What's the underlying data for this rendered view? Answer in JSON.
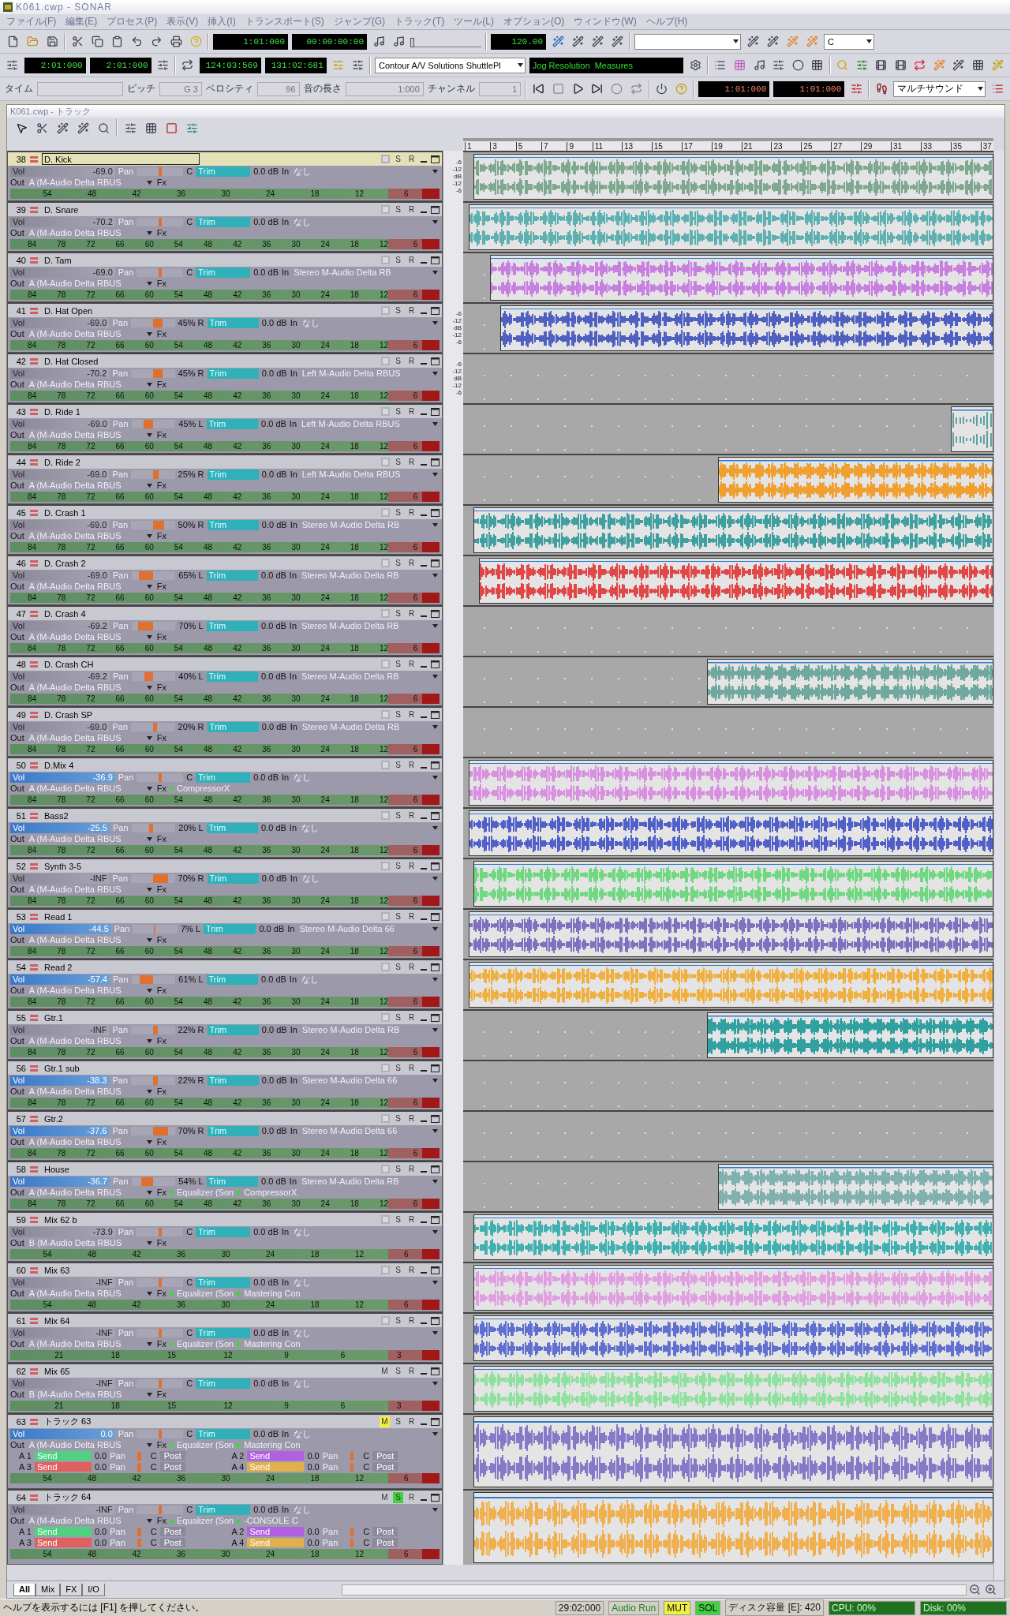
{
  "window": {
    "title": "K061.cwp - SONAR"
  },
  "menu": [
    "ファイル(F)",
    "編集(E)",
    "プロセス(P)",
    "表示(V)",
    "挿入(I)",
    "トランスポート(S)",
    "ジャンプ(G)",
    "トラック(T)",
    "ツール(L)",
    "オプション(O)",
    "ウィンドウ(W)",
    "ヘルプ(H)"
  ],
  "toolbar_1": {
    "now_time": "1:01:000",
    "smpte": "00:00:00:00",
    "tempo": "120.00",
    "position": {
      "level": 0
    },
    "key_combo": "C"
  },
  "toolbar_2": {
    "from": "2:01:000",
    "thru": "2:01:000",
    "loop_start": "124:03:569",
    "loop_end": "131:02:681",
    "controller_combo": "Contour A/V Solutions ShuttlePl",
    "jog_display": "Jog Resolution  Measures"
  },
  "toolbar_3": {
    "event_fields": [
      {
        "label": "タイム",
        "disabled": true
      },
      {
        "label": "ピッチ",
        "value": "G 3",
        "disabled": true
      },
      {
        "label": "ベロシティ",
        "value": "96",
        "disabled": true
      },
      {
        "label": "音の長さ",
        "value": "1:000",
        "disabled": true
      },
      {
        "label": "チャンネル",
        "value": "1",
        "disabled": true
      }
    ],
    "punch_in": "1:01:000",
    "punch_out": "1:01:000",
    "sound_combo": "マルチサウンド"
  },
  "track_window": {
    "title": "K061.cwp - トラック"
  },
  "ruler": [
    "1",
    "3",
    "5",
    "7",
    "9",
    "11",
    "13",
    "15",
    "17",
    "19",
    "21",
    "23",
    "25",
    "27",
    "29",
    "31",
    "33",
    "35",
    "37"
  ],
  "tracks": [
    {
      "number": "38",
      "name": "D. Kick",
      "selected": true,
      "vol_label": "Vol",
      "vol": "-69.0",
      "vol_highlighted": false,
      "pan_label": "Pan",
      "pan": "C",
      "trim": "Trim",
      "trim_value": "0.0 dB",
      "in_label": "In",
      "input": "なし",
      "out_label": "Out",
      "output": "A (M-Audio Delta RBUS",
      "fx_label": "Fx",
      "meter": [
        "54",
        "48",
        "42",
        "36",
        "30",
        "24",
        "18",
        "12",
        "6"
      ],
      "muted": false,
      "solo_label": "S",
      "soloed": false,
      "record_label": "R",
      "db_scale": [
        "-6",
        "-12",
        "dB",
        "-12",
        "-6"
      ],
      "clip": {
        "color": "#7fa890"
      }
    },
    {
      "number": "39",
      "name": "D. Snare",
      "selected": false,
      "vol_label": "Vol",
      "vol": "-70.2",
      "vol_highlighted": false,
      "pan_label": "Pan",
      "pan": "C",
      "trim": "Trim",
      "trim_value": "0.0 dB",
      "in_label": "In",
      "input": "なし",
      "out_label": "Out",
      "output": "A (M-Audio Delta RBUS",
      "fx_label": "Fx",
      "meter": [
        "84",
        "78",
        "72",
        "66",
        "60",
        "54",
        "48",
        "42",
        "36",
        "30",
        "24",
        "18",
        "12",
        "6"
      ],
      "muted": false,
      "solo_label": "S",
      "soloed": false,
      "record_label": "R",
      "clip": {
        "color": "#5fb0b0"
      }
    },
    {
      "number": "40",
      "name": "D. Tam",
      "selected": false,
      "vol_label": "Vol",
      "vol": "-69.0",
      "vol_highlighted": false,
      "pan_label": "Pan",
      "pan": "C",
      "trim": "Trim",
      "trim_value": "0.0 dB",
      "in_label": "In",
      "input": "Stereo M-Audio Delta RB",
      "out_label": "Out",
      "output": "A (M-Audio Delta RBUS",
      "fx_label": "Fx",
      "meter": [
        "84",
        "78",
        "72",
        "66",
        "60",
        "54",
        "48",
        "42",
        "36",
        "30",
        "24",
        "18",
        "12",
        "6"
      ],
      "muted": false,
      "solo_label": "S",
      "soloed": false,
      "record_label": "R",
      "clip": {
        "color": "#c880e0"
      }
    },
    {
      "number": "41",
      "name": "D. Hat Open",
      "selected": false,
      "vol_label": "Vol",
      "vol": "-69.0",
      "vol_highlighted": false,
      "pan_label": "Pan",
      "pan": "45% R",
      "trim": "Trim",
      "trim_value": "0.0 dB",
      "in_label": "In",
      "input": "なし",
      "out_label": "Out",
      "output": "A (M-Audio Delta RBUS",
      "fx_label": "Fx",
      "meter": [
        "84",
        "78",
        "72",
        "66",
        "60",
        "54",
        "48",
        "42",
        "36",
        "30",
        "24",
        "18",
        "12",
        "6"
      ],
      "muted": false,
      "solo_label": "S",
      "soloed": false,
      "record_label": "R",
      "db_scale": [
        "-6",
        "-12",
        "dB",
        "-12",
        "-6"
      ],
      "clip": {
        "color": "#5060c0"
      }
    },
    {
      "number": "42",
      "name": "D. Hat Closed",
      "selected": false,
      "vol_label": "Vol",
      "vol": "-70.2",
      "vol_highlighted": false,
      "pan_label": "Pan",
      "pan": "45% R",
      "trim": "Trim",
      "trim_value": "0.0 dB",
      "in_label": "In",
      "input": "Left M-Audio Delta RBUS",
      "out_label": "Out",
      "output": "A (M-Audio Delta RBUS",
      "fx_label": "Fx",
      "meter": [
        "84",
        "78",
        "72",
        "66",
        "60",
        "54",
        "48",
        "42",
        "36",
        "30",
        "24",
        "18",
        "12",
        "6"
      ],
      "muted": false,
      "solo_label": "S",
      "soloed": false,
      "record_label": "R",
      "db_scale": [
        "-6",
        "-12",
        "dB",
        "-12",
        "-6"
      ]
    },
    {
      "number": "43",
      "name": "D. Ride 1",
      "selected": false,
      "vol_label": "Vol",
      "vol": "-69.0",
      "vol_highlighted": false,
      "pan_label": "Pan",
      "pan": "45% L",
      "trim": "Trim",
      "trim_value": "0.0 dB",
      "in_label": "In",
      "input": "Left M-Audio Delta RBUS",
      "out_label": "Out",
      "output": "A (M-Audio Delta RBUS",
      "fx_label": "Fx",
      "meter": [
        "84",
        "78",
        "72",
        "66",
        "60",
        "54",
        "48",
        "42",
        "36",
        "30",
        "24",
        "18",
        "12",
        "6"
      ],
      "muted": false,
      "solo_label": "S",
      "soloed": false,
      "record_label": "R",
      "clip": {
        "color": "#60a0a0"
      }
    },
    {
      "number": "44",
      "name": "D. Ride 2",
      "selected": false,
      "vol_label": "Vol",
      "vol": "-69.0",
      "vol_highlighted": false,
      "pan_label": "Pan",
      "pan": "25% R",
      "trim": "Trim",
      "trim_value": "0.0 dB",
      "in_label": "In",
      "input": "Left M-Audio Delta RBUS",
      "out_label": "Out",
      "output": "A (M-Audio Delta RBUS",
      "fx_label": "Fx",
      "meter": [
        "84",
        "78",
        "72",
        "66",
        "60",
        "54",
        "48",
        "42",
        "36",
        "30",
        "24",
        "18",
        "12",
        "6"
      ],
      "muted": false,
      "solo_label": "S",
      "soloed": false,
      "record_label": "R",
      "clip": {
        "color": "#f0a030"
      }
    },
    {
      "number": "45",
      "name": "D. Crash 1",
      "selected": false,
      "vol_label": "Vol",
      "vol": "-69.0",
      "vol_highlighted": false,
      "pan_label": "Pan",
      "pan": "50% R",
      "trim": "Trim",
      "trim_value": "0.0 dB",
      "in_label": "In",
      "input": "Stereo M-Audio Delta RB",
      "out_label": "Out",
      "output": "A (M-Audio Delta RBUS",
      "fx_label": "Fx",
      "meter": [
        "84",
        "78",
        "72",
        "66",
        "60",
        "54",
        "48",
        "42",
        "36",
        "30",
        "24",
        "18",
        "12",
        "6"
      ],
      "muted": false,
      "solo_label": "S",
      "soloed": false,
      "record_label": "R",
      "clip": {
        "color": "#40a0a0"
      }
    },
    {
      "number": "46",
      "name": "D. Crash 2",
      "selected": false,
      "vol_label": "Vol",
      "vol": "-69.0",
      "vol_highlighted": false,
      "pan_label": "Pan",
      "pan": "65% L",
      "trim": "Trim",
      "trim_value": "0.0 dB",
      "in_label": "In",
      "input": "Stereo M-Audio Delta RB",
      "out_label": "Out",
      "output": "A (M-Audio Delta RBUS",
      "fx_label": "Fx",
      "meter": [
        "84",
        "78",
        "72",
        "66",
        "60",
        "54",
        "48",
        "42",
        "36",
        "30",
        "24",
        "18",
        "12",
        "6"
      ],
      "muted": false,
      "solo_label": "S",
      "soloed": false,
      "record_label": "R",
      "clip": {
        "color": "#e04848"
      }
    },
    {
      "number": "47",
      "name": "D. Crash 4",
      "selected": false,
      "vol_label": "Vol",
      "vol": "-69.2",
      "vol_highlighted": false,
      "pan_label": "Pan",
      "pan": "70% L",
      "trim": "Trim",
      "trim_value": "0.0 dB",
      "in_label": "In",
      "input": "Stereo M-Audio Delta RB",
      "out_label": "Out",
      "output": "A (M-Audio Delta RBUS",
      "fx_label": "Fx",
      "meter": [
        "84",
        "78",
        "72",
        "66",
        "60",
        "54",
        "48",
        "42",
        "36",
        "30",
        "24",
        "18",
        "12",
        "6"
      ],
      "muted": false,
      "solo_label": "S",
      "soloed": false,
      "record_label": "R"
    },
    {
      "number": "48",
      "name": "D. Crash CH",
      "selected": false,
      "vol_label": "Vol",
      "vol": "-69.2",
      "vol_highlighted": false,
      "pan_label": "Pan",
      "pan": "40% L",
      "trim": "Trim",
      "trim_value": "0.0 dB",
      "in_label": "In",
      "input": "Stereo M-Audio Delta RB",
      "out_label": "Out",
      "output": "A (M-Audio Delta RBUS",
      "fx_label": "Fx",
      "meter": [
        "84",
        "78",
        "72",
        "66",
        "60",
        "54",
        "48",
        "42",
        "36",
        "30",
        "24",
        "18",
        "12",
        "6"
      ],
      "muted": false,
      "solo_label": "S",
      "soloed": false,
      "record_label": "R",
      "clip": {
        "color": "#70a8a0"
      }
    },
    {
      "number": "49",
      "name": "D. Crash SP",
      "selected": false,
      "vol_label": "Vol",
      "vol": "-69.0",
      "vol_highlighted": false,
      "pan_label": "Pan",
      "pan": "20% R",
      "trim": "Trim",
      "trim_value": "0.0 dB",
      "in_label": "In",
      "input": "Stereo M-Audio Delta RB",
      "out_label": "Out",
      "output": "A (M-Audio Delta RBUS",
      "fx_label": "Fx",
      "meter": [
        "84",
        "78",
        "72",
        "66",
        "60",
        "54",
        "48",
        "42",
        "36",
        "30",
        "24",
        "18",
        "12",
        "6"
      ],
      "muted": false,
      "solo_label": "S",
      "soloed": false,
      "record_label": "R"
    },
    {
      "number": "50",
      "name": "D.Mix 4",
      "selected": false,
      "vol_label": "Vol",
      "vol": "-36.9",
      "vol_highlighted": true,
      "pan_label": "Pan",
      "pan": "C",
      "trim": "Trim",
      "trim_value": "0.0 dB",
      "in_label": "In",
      "input": "なし",
      "out_label": "Out",
      "output": "A (M-Audio Delta RBUS",
      "fx_label": "Fx",
      "fx": [
        "CompressorX"
      ],
      "meter": [
        "84",
        "78",
        "72",
        "66",
        "60",
        "54",
        "48",
        "42",
        "36",
        "30",
        "24",
        "18",
        "12",
        "6"
      ],
      "muted": false,
      "solo_label": "S",
      "soloed": false,
      "record_label": "R",
      "clip": {
        "color": "#d890e0"
      }
    },
    {
      "number": "51",
      "name": "Bass2",
      "selected": false,
      "vol_label": "Vol",
      "vol": "-25.5",
      "vol_highlighted": true,
      "pan_label": "Pan",
      "pan": "20% L",
      "trim": "Trim",
      "trim_value": "0.0 dB",
      "in_label": "In",
      "input": "なし",
      "out_label": "Out",
      "output": "A (M-Audio Delta RBUS",
      "fx_label": "Fx",
      "meter": [
        "84",
        "78",
        "72",
        "66",
        "60",
        "54",
        "48",
        "42",
        "36",
        "30",
        "24",
        "18",
        "12",
        "6"
      ],
      "muted": false,
      "solo_label": "S",
      "soloed": false,
      "record_label": "R",
      "clip": {
        "color": "#5060c8"
      }
    },
    {
      "number": "52",
      "name": "Synth 3-5",
      "selected": false,
      "vol_label": "Vol",
      "vol": "-INF",
      "vol_highlighted": false,
      "pan_label": "Pan",
      "pan": "70% R",
      "trim": "Trim",
      "trim_value": "0.0 dB",
      "in_label": "In",
      "input": "なし",
      "out_label": "Out",
      "output": "A (M-Audio Delta RBUS",
      "fx_label": "Fx",
      "meter": [
        "84",
        "78",
        "72",
        "66",
        "60",
        "54",
        "48",
        "42",
        "36",
        "30",
        "24",
        "18",
        "12",
        "6"
      ],
      "muted": false,
      "solo_label": "S",
      "soloed": false,
      "record_label": "R",
      "clip": {
        "color": "#70d880"
      }
    },
    {
      "number": "53",
      "name": "Read 1",
      "selected": false,
      "vol_label": "Vol",
      "vol": "-44.5",
      "vol_highlighted": true,
      "pan_label": "Pan",
      "pan": "7% L",
      "trim": "Trim",
      "trim_value": "0.0 dB",
      "in_label": "In",
      "input": "Stereo M-Audio Delta 66",
      "out_label": "Out",
      "output": "A (M-Audio Delta RBUS",
      "fx_label": "Fx",
      "meter": [
        "84",
        "78",
        "72",
        "66",
        "60",
        "54",
        "48",
        "42",
        "36",
        "30",
        "24",
        "18",
        "12",
        "6"
      ],
      "muted": false,
      "solo_label": "S",
      "soloed": false,
      "record_label": "R",
      "clip": {
        "color": "#8070c0"
      }
    },
    {
      "number": "54",
      "name": "Read 2",
      "selected": false,
      "vol_label": "Vol",
      "vol": "-57.4",
      "vol_highlighted": true,
      "pan_label": "Pan",
      "pan": "61% L",
      "trim": "Trim",
      "trim_value": "0.0 dB",
      "in_label": "In",
      "input": "なし",
      "out_label": "Out",
      "output": "A (M-Audio Delta RBUS",
      "fx_label": "Fx",
      "meter": [
        "84",
        "78",
        "72",
        "66",
        "60",
        "54",
        "48",
        "42",
        "36",
        "30",
        "24",
        "18",
        "12",
        "6"
      ],
      "muted": false,
      "solo_label": "S",
      "soloed": false,
      "record_label": "R",
      "clip": {
        "color": "#f0b040"
      }
    },
    {
      "number": "55",
      "name": "Gtr.1",
      "selected": false,
      "vol_label": "Vol",
      "vol": "-INF",
      "vol_highlighted": false,
      "pan_label": "Pan",
      "pan": "22% R",
      "trim": "Trim",
      "trim_value": "0.0 dB",
      "in_label": "In",
      "input": "Stereo M-Audio Delta RB",
      "out_label": "Out",
      "output": "A (M-Audio Delta RBUS",
      "fx_label": "Fx",
      "meter": [
        "84",
        "78",
        "72",
        "66",
        "60",
        "54",
        "48",
        "42",
        "36",
        "30",
        "24",
        "18",
        "12",
        "6"
      ],
      "muted": false,
      "solo_label": "S",
      "soloed": false,
      "record_label": "R",
      "clip": {
        "color": "#30a0a0"
      }
    },
    {
      "number": "56",
      "name": "Gtr.1 sub",
      "selected": false,
      "vol_label": "Vol",
      "vol": "-38.3",
      "vol_highlighted": true,
      "pan_label": "Pan",
      "pan": "22% R",
      "trim": "Trim",
      "trim_value": "0.0 dB",
      "in_label": "In",
      "input": "Stereo M-Audio Delta 66",
      "out_label": "Out",
      "output": "A (M-Audio Delta RBUS",
      "fx_label": "Fx",
      "meter": [
        "84",
        "78",
        "72",
        "66",
        "60",
        "54",
        "48",
        "42",
        "36",
        "30",
        "24",
        "18",
        "12",
        "6"
      ],
      "muted": false,
      "solo_label": "S",
      "soloed": false,
      "record_label": "R"
    },
    {
      "number": "57",
      "name": "Gtr.2",
      "selected": false,
      "vol_label": "Vol",
      "vol": "-37.6",
      "vol_highlighted": true,
      "pan_label": "Pan",
      "pan": "70% R",
      "trim": "Trim",
      "trim_value": "0.0 dB",
      "in_label": "In",
      "input": "Stereo M-Audio Delta 66",
      "out_label": "Out",
      "output": "A (M-Audio Delta RBUS",
      "fx_label": "Fx",
      "meter": [
        "84",
        "78",
        "72",
        "66",
        "60",
        "54",
        "48",
        "42",
        "36",
        "30",
        "24",
        "18",
        "12",
        "6"
      ],
      "muted": false,
      "solo_label": "S",
      "soloed": false,
      "record_label": "R"
    },
    {
      "number": "58",
      "name": "House",
      "selected": false,
      "vol_label": "Vol",
      "vol": "-36.7",
      "vol_highlighted": true,
      "pan_label": "Pan",
      "pan": "54% L",
      "trim": "Trim",
      "trim_value": "0.0 dB",
      "in_label": "In",
      "input": "Stereo M-Audio Delta RB",
      "out_label": "Out",
      "output": "A (M-Audio Delta RBUS",
      "fx_label": "Fx",
      "fx": [
        "Equalizer (Son",
        "CompressorX"
      ],
      "meter": [
        "84",
        "78",
        "72",
        "66",
        "60",
        "54",
        "48",
        "42",
        "36",
        "30",
        "24",
        "18",
        "12",
        "6"
      ],
      "muted": false,
      "solo_label": "S",
      "soloed": false,
      "record_label": "R",
      "clip": {
        "color": "#80b0b0"
      }
    },
    {
      "number": "59",
      "name": "Mix 62 b",
      "selected": false,
      "vol_label": "Vol",
      "vol": "-73.9",
      "vol_highlighted": false,
      "pan_label": "Pan",
      "pan": "C",
      "trim": "Trim",
      "trim_value": "0.0 dB",
      "in_label": "In",
      "input": "なし",
      "out_label": "Out",
      "output": "B (M-Audio Delta RBUS",
      "fx_label": "Fx",
      "meter": [
        "54",
        "48",
        "42",
        "36",
        "30",
        "24",
        "18",
        "12",
        "6"
      ],
      "muted": false,
      "solo_label": "S",
      "soloed": false,
      "record_label": "R",
      "clip": {
        "color": "#40b0b0"
      }
    },
    {
      "number": "60",
      "name": "Mix 63",
      "selected": false,
      "vol_label": "Vol",
      "vol": "-INF",
      "vol_highlighted": false,
      "pan_label": "Pan",
      "pan": "C",
      "trim": "Trim",
      "trim_value": "0.0 dB",
      "in_label": "In",
      "input": "なし",
      "out_label": "Out",
      "output": "A (M-Audio Delta RBUS",
      "fx_label": "Fx",
      "fx": [
        "Equalizer (Son",
        "Mastering Con"
      ],
      "meter": [
        "54",
        "48",
        "42",
        "36",
        "30",
        "24",
        "18",
        "12",
        "6"
      ],
      "muted": false,
      "solo_label": "S",
      "soloed": false,
      "record_label": "R",
      "clip": {
        "color": "#e0a0e0"
      }
    },
    {
      "number": "61",
      "name": "Mix 64",
      "selected": false,
      "vol_label": "Vol",
      "vol": "-INF",
      "vol_highlighted": false,
      "pan_label": "Pan",
      "pan": "C",
      "trim": "Trim",
      "trim_value": "0.0 dB",
      "in_label": "In",
      "input": "なし",
      "out_label": "Out",
      "output": "A (M-Audio Delta RBUS",
      "fx_label": "Fx",
      "fx": [
        "Equalizer (Son",
        "Mastering Con"
      ],
      "meter": [
        "21",
        "18",
        "15",
        "12",
        "9",
        "6",
        "3"
      ],
      "muted": false,
      "solo_label": "S",
      "soloed": false,
      "record_label": "R",
      "clip": {
        "color": "#6070d0"
      }
    },
    {
      "number": "62",
      "name": "Mix 65",
      "selected": false,
      "vol_label": "Vol",
      "vol": "-INF",
      "vol_highlighted": false,
      "pan_label": "Pan",
      "pan": "C",
      "trim": "Trim",
      "trim_value": "0.0 dB",
      "in_label": "In",
      "input": "なし",
      "out_label": "Out",
      "output": "B (M-Audio Delta RBUS",
      "fx_label": "Fx",
      "meter": [
        "21",
        "18",
        "15",
        "12",
        "9",
        "6",
        "3"
      ],
      "mute_label": "M",
      "muted": false,
      "solo_label": "S",
      "soloed": false,
      "record_label": "R",
      "clip": {
        "color": "#90e0a0"
      }
    },
    {
      "number": "63",
      "name": "トラック 63",
      "selected": false,
      "vol_label": "Vol",
      "vol": "0.0",
      "vol_highlighted": true,
      "pan_label": "Pan",
      "pan": "C",
      "trim": "Trim",
      "trim_value": "0.0 dB",
      "in_label": "In",
      "input": "なし",
      "out_label": "Out",
      "output": "A (M-Audio Delta RBUS",
      "fx_label": "Fx",
      "fx": [
        "Equalizer (Son",
        "Mastering Con"
      ],
      "meter": [
        "54",
        "48",
        "42",
        "36",
        "30",
        "24",
        "18",
        "12",
        "6"
      ],
      "mute_label": "M",
      "muted": true,
      "solo_label": "S",
      "soloed": false,
      "record_label": "R",
      "clip": {
        "color": "#8878c8"
      },
      "sends": [
        {
          "bus": "A 1",
          "label": "Send",
          "value": "0.0",
          "pan_label": "Pan",
          "pan": "C",
          "mode": "Post",
          "color": "#50d080"
        },
        {
          "bus": "A 2",
          "label": "Send",
          "value": "0.0",
          "pan_label": "Pan",
          "pan": "C",
          "mode": "Post",
          "color": "#b060e0"
        },
        {
          "bus": "A 3",
          "label": "Send",
          "value": "0.0",
          "pan_label": "Pan",
          "pan": "C",
          "mode": "Post",
          "color": "#e06060"
        },
        {
          "bus": "A 4",
          "label": "Send",
          "value": "0.0",
          "pan_label": "Pan",
          "pan": "C",
          "mode": "Post",
          "color": "#e0b050"
        }
      ]
    },
    {
      "number": "64",
      "name": "トラック 64",
      "selected": false,
      "vol_label": "Vol",
      "vol": "-INF",
      "vol_highlighted": false,
      "pan_label": "Pan",
      "pan": "C",
      "trim": "Trim",
      "trim_value": "0.0 dB",
      "in_label": "In",
      "input": "なし",
      "out_label": "Out",
      "output": "A (M-Audio Delta RBUS",
      "fx_label": "Fx",
      "fx": [
        "Equalizer (Son",
        "-CONSOLE C"
      ],
      "meter": [
        "54",
        "48",
        "42",
        "36",
        "30",
        "24",
        "18",
        "12",
        "6"
      ],
      "mute_label": "M",
      "muted": false,
      "solo_label": "S",
      "soloed": true,
      "record_label": "R",
      "clip": {
        "color": "#f0b050"
      },
      "sends": [
        {
          "bus": "A 1",
          "label": "Send",
          "value": "0.0",
          "pan_label": "Pan",
          "pan": "C",
          "mode": "Post",
          "color": "#50d080"
        },
        {
          "bus": "A 2",
          "label": "Send",
          "value": "0.0",
          "pan_label": "Pan",
          "pan": "C",
          "mode": "Post",
          "color": "#b060e0"
        },
        {
          "bus": "A 3",
          "label": "Send",
          "value": "0.0",
          "pan_label": "Pan",
          "pan": "C",
          "mode": "Post",
          "color": "#e06060"
        },
        {
          "bus": "A 4",
          "label": "Send",
          "value": "0.0",
          "pan_label": "Pan",
          "pan": "C",
          "mode": "Post",
          "color": "#e0b050"
        }
      ]
    }
  ],
  "view_tabs": [
    {
      "label": "All",
      "selected": true
    },
    {
      "label": "Mix",
      "selected": false
    },
    {
      "label": "FX",
      "selected": false
    },
    {
      "label": "I/O",
      "selected": false
    }
  ],
  "status_bar": {
    "help": "ヘルプを表示するには [F1] を押してください。",
    "time": "29:02:000",
    "audio": "Audio Run",
    "mute": "MUT",
    "solo": "SOL",
    "disk_space": "ディスク容量 [E]: 420",
    "cpu": "CPU: 00%",
    "disk": "Disk: 00%"
  }
}
